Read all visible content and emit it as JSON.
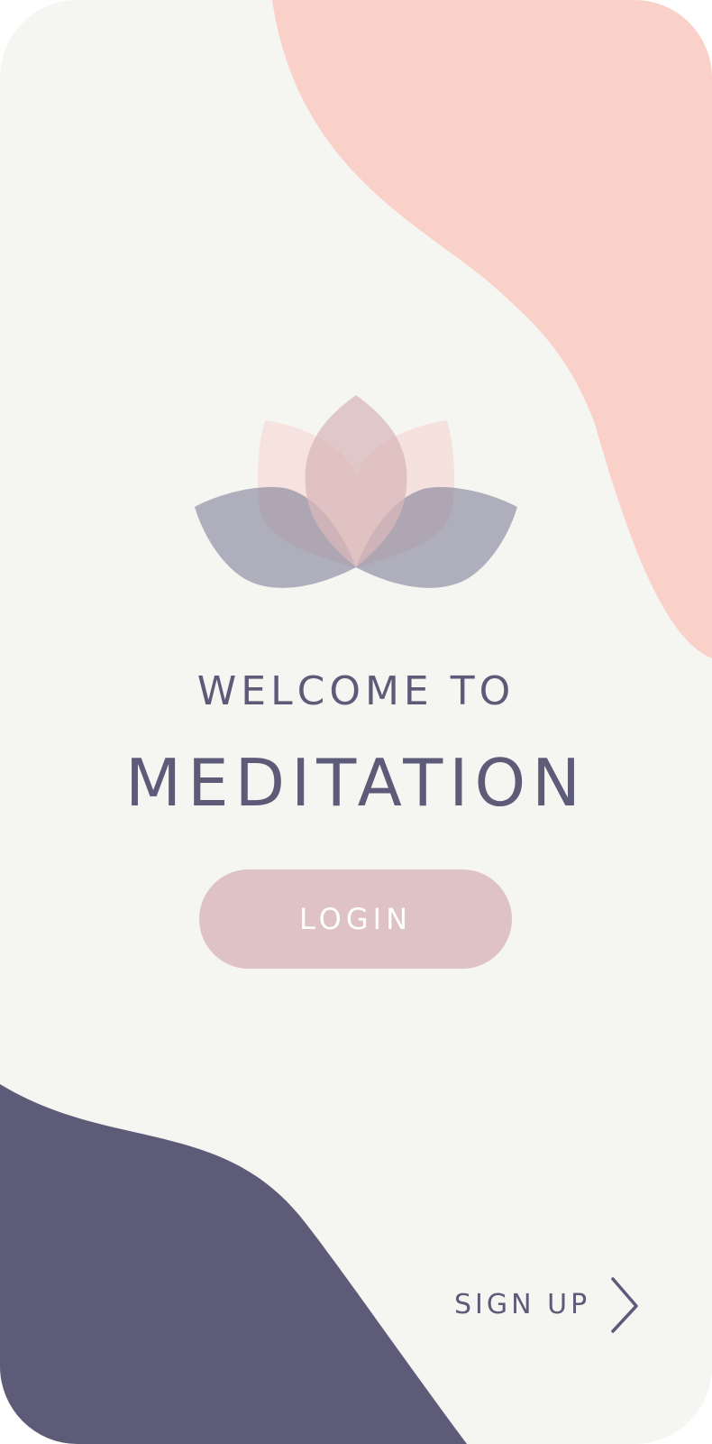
{
  "screen": {
    "welcome_text": "WELCOME TO",
    "app_name": "MEDITATION",
    "login_label": "LOGIN",
    "signup_label": "SIGN UP"
  },
  "icons": {
    "logo": "lotus-flower-icon",
    "signup_arrow": "chevron-right-icon"
  },
  "colors": {
    "background": "#f5f5f2",
    "accent_pink": "#f9d1c8",
    "accent_navy": "#5d5b78",
    "button": "#dfc2c3",
    "button_text": "#ffffff"
  }
}
